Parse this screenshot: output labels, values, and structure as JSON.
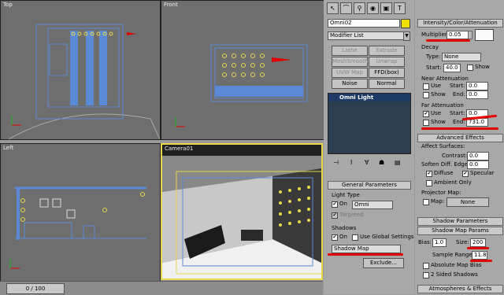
{
  "viewports": {
    "top": {
      "label": "Top"
    },
    "front": {
      "label": "Front"
    },
    "left": {
      "label": "Left"
    },
    "camera": {
      "label": "Camera01"
    }
  },
  "timebar": {
    "slider": "0 / 100"
  },
  "toolbar": {
    "icons": [
      "pointer-icon",
      "modify-icon",
      "hierarchy-icon",
      "motion-icon",
      "display-icon",
      "utilities-icon"
    ]
  },
  "modify": {
    "object_name": "Omni02",
    "swatch_color": "#f0e000",
    "modifier_list": "Modifier List",
    "buttons": [
      "Lathe",
      "Extrude",
      "MeshSmooth",
      "Unwrap UVW",
      "UVW Map",
      "FFD(box)",
      "Noise",
      "Normal"
    ],
    "stack_item": "Omni Light"
  },
  "general": {
    "title": "General Parameters",
    "light_type": "Light Type",
    "on": "On",
    "type_value": "Omni",
    "targeted": "Targeted",
    "shadows": "Shadows",
    "shadows_on": "On",
    "use_global": "Use Global Settings",
    "shadow_type": "Shadow Map",
    "exclude": "Exclude..."
  },
  "intensity": {
    "title": "Intensity/Color/Attenuation",
    "multiplier_label": "Multiplier:",
    "multiplier": "0.05",
    "decay": "Decay",
    "type_label": "Type:",
    "type_value": "None",
    "start_label": "Start:",
    "start_value": "40.0",
    "show": "Show",
    "near": "Near Attenuation",
    "near_use": "Use",
    "near_start_label": "Start:",
    "near_start": "0.0",
    "near_show": "Show",
    "near_end_label": "End:",
    "near_end": "0.0",
    "far": "Far Attenuation",
    "far_use": "Use",
    "far_start_label": "Start:",
    "far_start": "0.0",
    "far_show": "Show",
    "far_end_label": "End:",
    "far_end": "731.0"
  },
  "advanced": {
    "title": "Advanced Effects",
    "affect": "Affect Surfaces:",
    "contrast_label": "Contrast:",
    "contrast": "0.0",
    "soften_label": "Soften Diff. Edge:",
    "soften": "0.0",
    "diffuse": "Diffuse",
    "specular": "Specular",
    "ambient": "Ambient Only",
    "projector": "Projector Map:",
    "map": "Map:",
    "map_value": "None"
  },
  "shadow_params": {
    "title": "Shadow Parameters"
  },
  "shadow_map": {
    "title": "Shadow Map Params",
    "bias_label": "Bias:",
    "bias": "1.0",
    "size_label": "Size:",
    "size": "200",
    "sample_label": "Sample Range:",
    "sample": "11.8",
    "absolute": "Absolute Map Bias",
    "two_sided": "2 Sided Shadows"
  },
  "atmos": {
    "title": "Atmospheres & Effects"
  }
}
